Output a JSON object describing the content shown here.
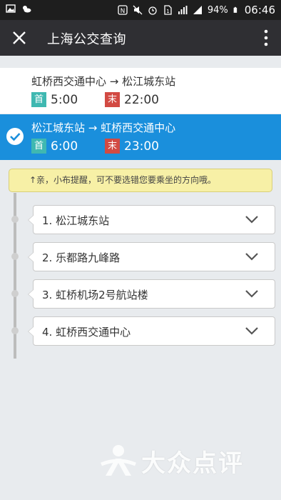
{
  "status_bar": {
    "battery": "94%",
    "time": "06:46"
  },
  "app_bar": {
    "title": "上海公交查询"
  },
  "directions": [
    {
      "route": "虹桥西交通中心 → 松江城东站",
      "first_label": "首",
      "first_time": "5:00",
      "last_label": "末",
      "last_time": "22:00",
      "selected": false
    },
    {
      "route": "松江城东站 → 虹桥西交通中心",
      "first_label": "首",
      "first_time": "6:00",
      "last_label": "末",
      "last_time": "23:00",
      "selected": true
    }
  ],
  "tip": {
    "text": "↑亲，小布提醒，可不要选错您要乘坐的方向哦。"
  },
  "stops": [
    {
      "label": "1. 松江城东站"
    },
    {
      "label": "2. 乐都路九峰路"
    },
    {
      "label": "3. 虹桥机场2号航站楼"
    },
    {
      "label": "4. 虹桥西交通中心"
    }
  ],
  "watermark": {
    "text": "大众点评"
  },
  "colors": {
    "selected_bg": "#1a8fdc",
    "first_badge": "#3fb8b1",
    "last_badge": "#d24a43",
    "app_bar": "#2f2f33"
  }
}
